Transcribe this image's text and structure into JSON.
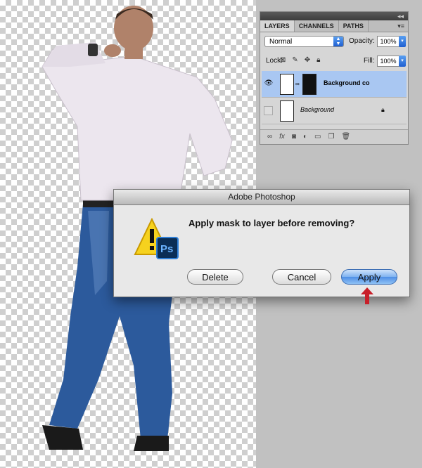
{
  "dialog": {
    "title": "Adobe Photoshop",
    "message": "Apply mask to layer before removing?",
    "buttons": {
      "delete": "Delete",
      "cancel": "Cancel",
      "apply": "Apply"
    },
    "icon": "warning-photoshop-icon"
  },
  "layers_panel": {
    "tabs": [
      "LAYERS",
      "CHANNELS",
      "PATHS"
    ],
    "blend_mode": "Normal",
    "opacity_label": "Opacity:",
    "opacity_value": "100%",
    "lock_label": "Lock:",
    "fill_label": "Fill:",
    "fill_value": "100%",
    "layers": [
      {
        "name": "Background co",
        "visible": true,
        "selected": true,
        "has_mask": true
      },
      {
        "name": "Background",
        "visible": false,
        "selected": false,
        "has_mask": false
      }
    ],
    "footer_icons": [
      "link-icon",
      "fx-icon",
      "add-mask-icon",
      "adjustment-icon",
      "folder-icon",
      "new-layer-icon",
      "trash-icon"
    ]
  },
  "colors": {
    "accent_blue": "#4f8fe6",
    "selection": "#a9c7f2",
    "annotation_red": "#c8202a",
    "gray_background": "#c1c1c1"
  }
}
